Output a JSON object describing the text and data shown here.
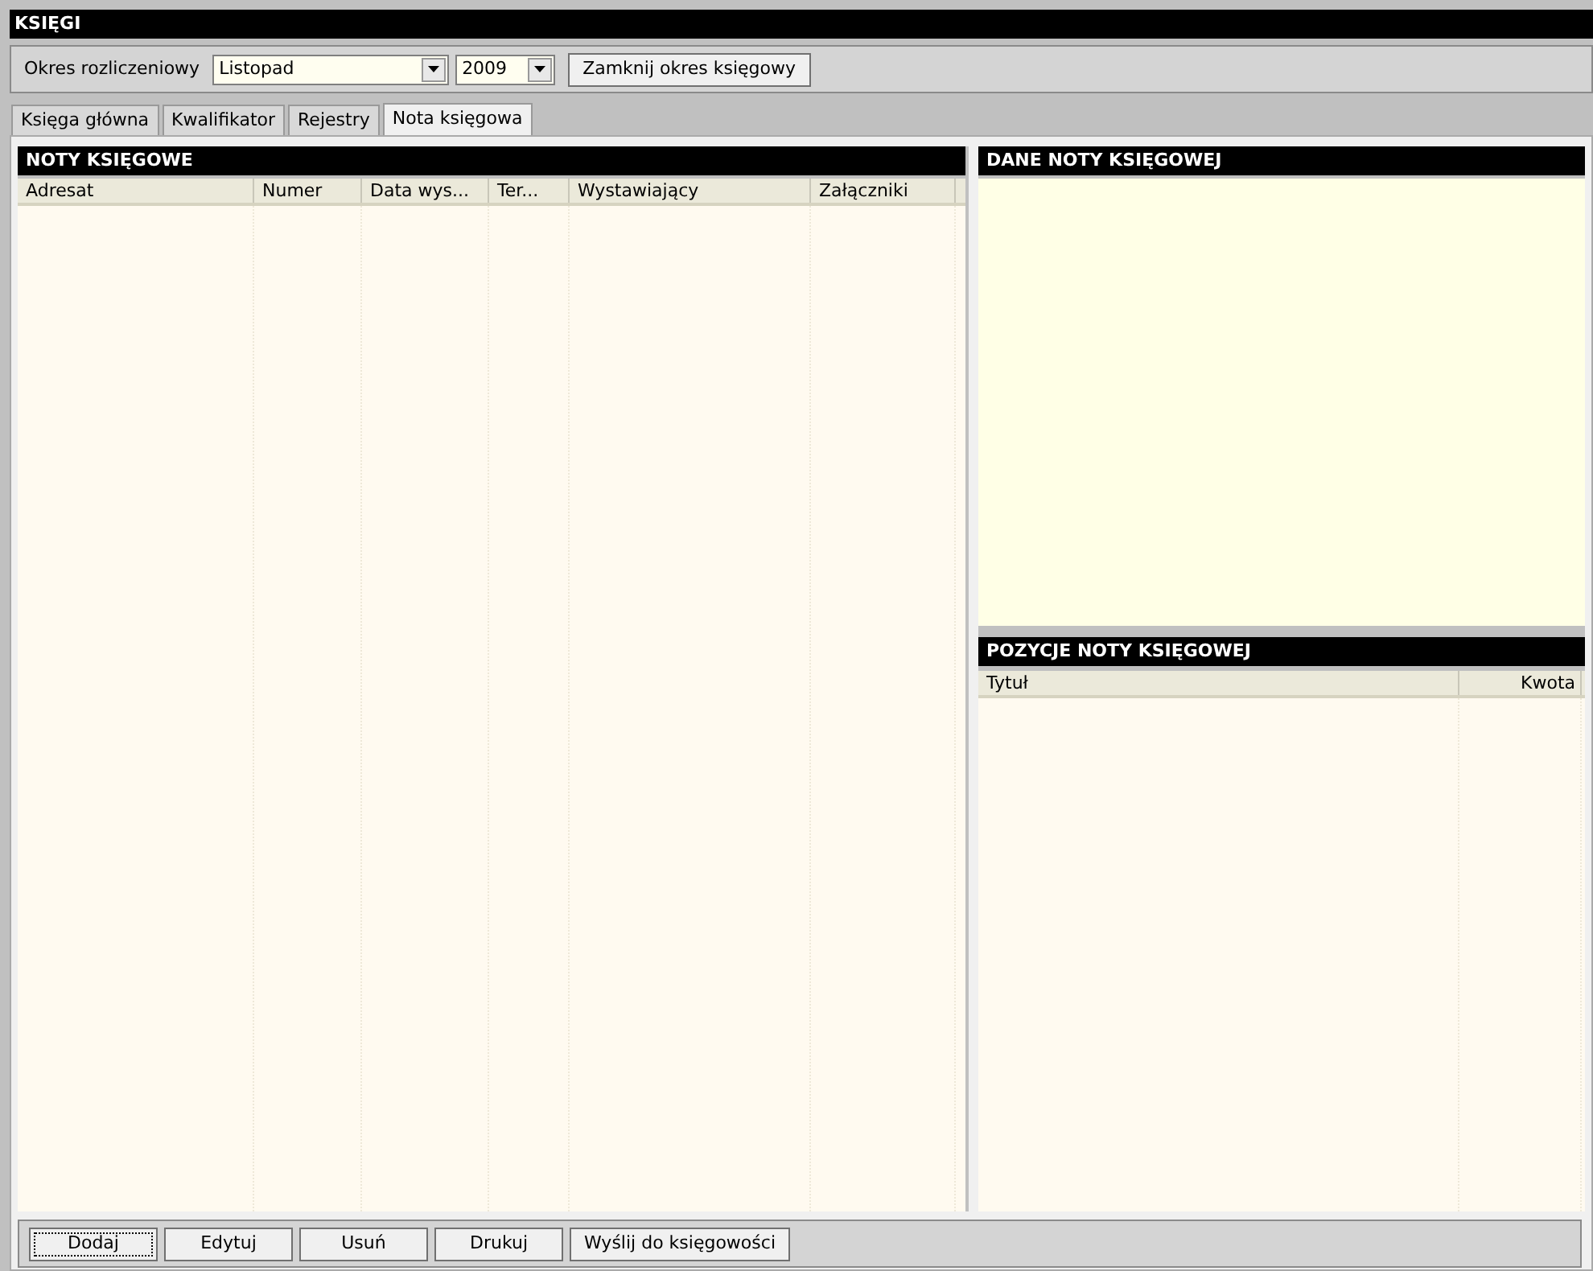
{
  "window": {
    "title": "KSIĘGI"
  },
  "period": {
    "label": "Okres rozliczeniowy",
    "month": "Listopad",
    "year": "2009",
    "close_button": "Zamknij okres księgowy"
  },
  "tabs": [
    {
      "label": "Księga główna",
      "selected": false
    },
    {
      "label": "Kwalifikator",
      "selected": false
    },
    {
      "label": "Rejestry",
      "selected": false
    },
    {
      "label": "Nota księgowa",
      "selected": true
    }
  ],
  "notes_panel": {
    "title": "NOTY KSIĘGOWE",
    "columns": [
      "Adresat",
      "Numer",
      "Data wys...",
      "Ter...",
      "Wystawiający",
      "Załączniki"
    ]
  },
  "details_panel": {
    "title": "DANE NOTY KSIĘGOWEJ"
  },
  "items_panel": {
    "title": "POZYCJE NOTY KSIĘGOWEJ",
    "columns": [
      "Tytuł",
      "Kwota"
    ]
  },
  "buttons": [
    {
      "label": "Dodaj",
      "focused": true
    },
    {
      "label": "Edytuj",
      "focused": false
    },
    {
      "label": "Usuń",
      "focused": false
    },
    {
      "label": "Drukuj",
      "focused": false
    },
    {
      "label": "Wyślij do księgowości",
      "focused": false
    }
  ]
}
